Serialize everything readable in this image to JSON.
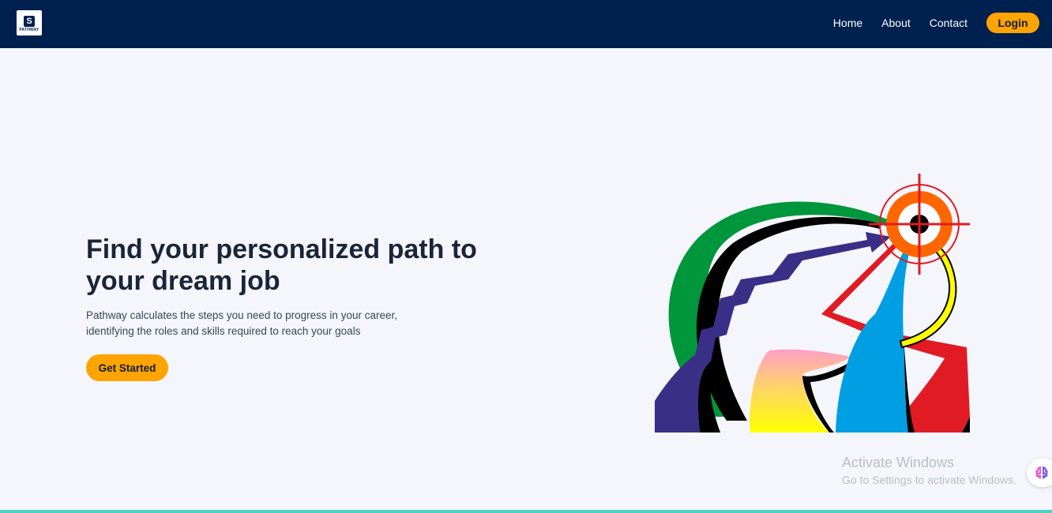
{
  "logo": {
    "mark": "S",
    "text": "PATHWAY"
  },
  "nav": {
    "links": [
      "Home",
      "About",
      "Contact"
    ],
    "login_label": "Login"
  },
  "hero": {
    "title": "Find your personalized path to your dream job",
    "description": "Pathway calculates the steps you need to progress in your career, identifying the roles and skills required to reach your goals",
    "cta_label": "Get Started"
  },
  "watermark": {
    "title": "Activate Windows",
    "subtitle": "Go to Settings to activate Windows."
  },
  "colors": {
    "navbar": "#00204f",
    "accent": "#ffa400",
    "page_bg": "#f4f6fb",
    "bottom_bar": "#4fd1c5"
  },
  "icons": {
    "illustration": "career-target-arrows-illustration",
    "floating_button": "brain-icon"
  }
}
